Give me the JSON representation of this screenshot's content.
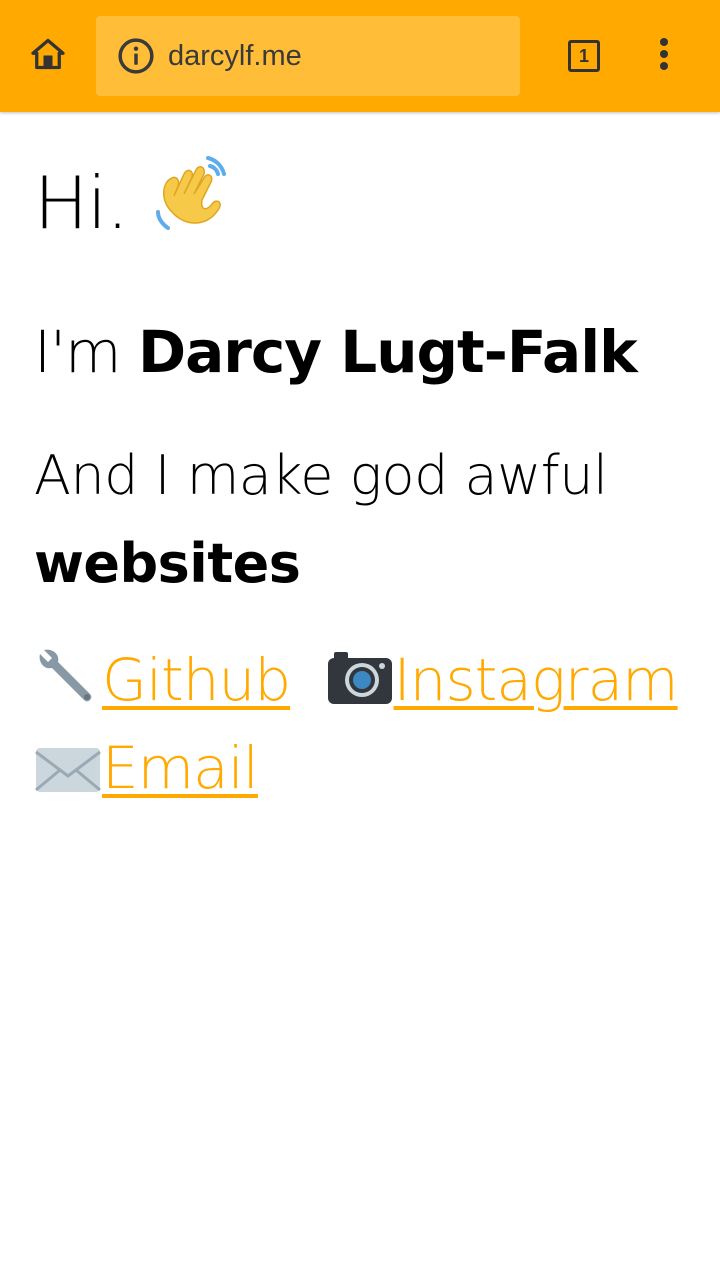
{
  "browser": {
    "url": "darcylf.me",
    "tab_count": "1",
    "accent": "#ffa901",
    "icons": [
      "home-icon",
      "info-icon",
      "tabs-icon",
      "more-vert-icon"
    ]
  },
  "page": {
    "greeting": "Hi.",
    "greeting_emoji": "👋",
    "intro_prefix": "I'm",
    "name": "Darcy Lugt-Falk",
    "tagline_prefix": "And I make god awful",
    "tagline_emphasis": "websites",
    "links": [
      {
        "icon": "wrench-icon",
        "label": "Github"
      },
      {
        "icon": "camera-icon",
        "label": "Instagram"
      },
      {
        "icon": "envelope-icon",
        "label": "Email"
      }
    ],
    "link_color": "#ffa901"
  }
}
